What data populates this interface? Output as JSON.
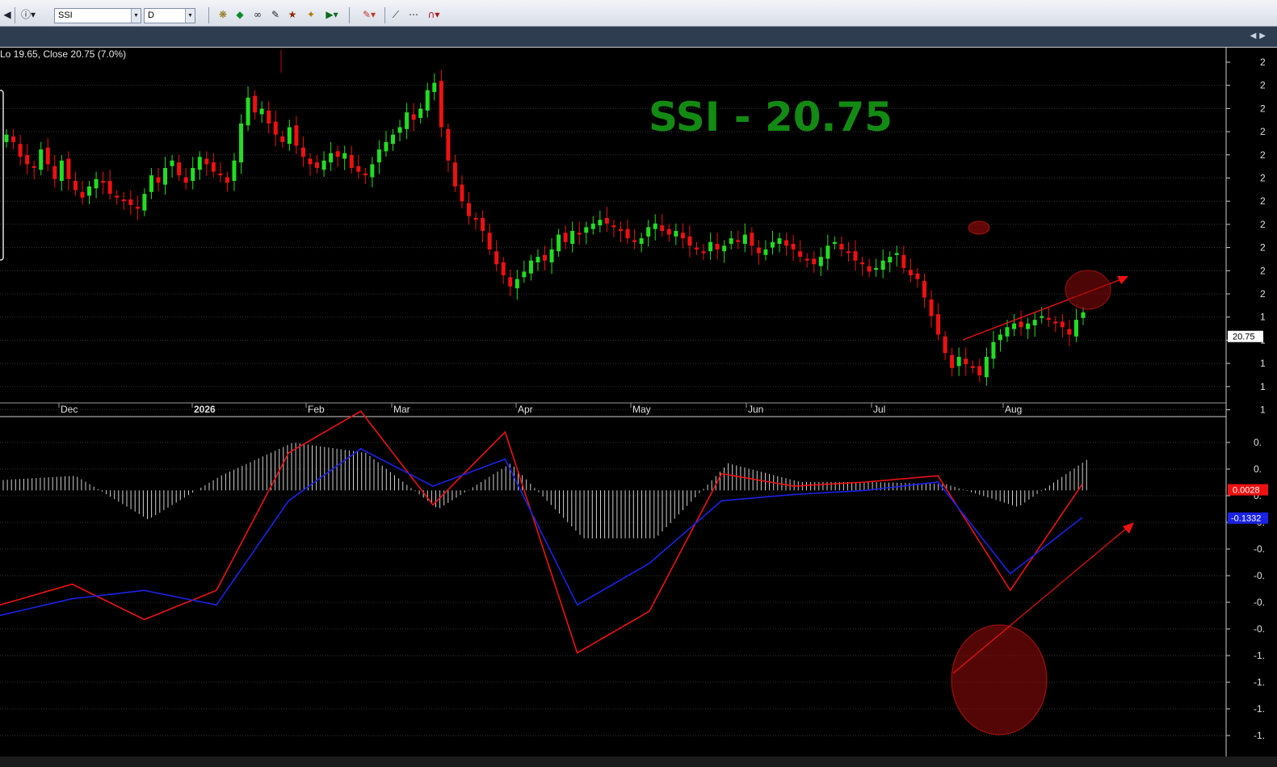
{
  "toolbar": {
    "symbol_value": "SSI",
    "interval_value": "D",
    "icons": [
      "back-icon",
      "info-icon",
      "symbol-dropdown",
      "interval-dropdown",
      "indicator-icon",
      "buy-icon",
      "glasses-icon",
      "pencil-icon",
      "wizard-icon",
      "magic-icon",
      "play-icon",
      "color-icon",
      "line-draw-icon",
      "dotted-line-icon",
      "magnet-icon"
    ]
  },
  "header": {
    "status_text": "Lo 19.65, Close 20.75 (7.0%)"
  },
  "annotation": {
    "title": "SSI - 20.75",
    "color": "#138a13"
  },
  "colors": {
    "background": "#000000",
    "up_candle": "#22dd22",
    "down_candle": "#ee1111",
    "macd_line": "#ee1111",
    "signal_line": "#1a22e6",
    "histogram": "#cfcfcf",
    "grid": "#333333",
    "price_badge": "#ffffff"
  },
  "chart_data": [
    {
      "type": "candlestick",
      "title": "",
      "last_close": 20.75,
      "price_badge": "20.75",
      "x_tick_labels": [
        "Dec",
        "2026",
        "Feb",
        "Mar",
        "Apr",
        "May",
        "Jun",
        "Jul",
        "Aug"
      ],
      "y_axis_labels": [
        "2",
        "2",
        "2",
        "2",
        "2",
        "2",
        "2",
        "2",
        "2",
        "2",
        "2",
        "1",
        "1",
        "1",
        "1",
        "1"
      ],
      "closes": [
        26.2,
        26.0,
        25.6,
        25.4,
        25.3,
        25.8,
        25.4,
        25.0,
        25.5,
        25.0,
        24.7,
        24.5,
        24.8,
        25.0,
        24.9,
        24.6,
        24.5,
        24.4,
        24.3,
        24.2,
        24.6,
        25.1,
        24.9,
        25.3,
        25.5,
        25.1,
        24.9,
        25.3,
        25.6,
        25.4,
        25.2,
        25.1,
        24.9,
        25.5,
        26.5,
        27.2,
        26.8,
        26.9,
        26.5,
        26.2,
        26.0,
        26.4,
        25.9,
        25.6,
        25.4,
        25.3,
        25.5,
        25.7,
        25.6,
        25.7,
        25.3,
        25.2,
        25.1,
        25.4,
        25.8,
        26.0,
        26.2,
        26.4,
        26.8,
        26.6,
        26.9,
        27.4,
        27.6,
        26.4,
        25.5,
        24.8,
        24.4,
        24.0,
        23.9,
        23.6,
        23.1,
        22.7,
        22.4,
        22.1,
        22.3,
        22.5,
        22.8,
        22.9,
        22.8,
        23.1,
        23.5,
        23.3,
        23.6,
        23.5,
        23.7,
        23.8,
        23.9,
        23.8,
        23.7,
        23.6,
        23.4,
        23.3,
        23.4,
        23.7,
        23.8,
        23.6,
        23.5,
        23.6,
        23.4,
        23.2,
        23.1,
        23.0,
        23.3,
        23.1,
        23.2,
        23.4,
        23.3,
        23.5,
        23.2,
        23.0,
        23.1,
        23.3,
        23.4,
        23.2,
        23.1,
        22.9,
        22.8,
        22.7,
        22.9,
        23.2,
        23.3,
        23.1,
        23.0,
        22.8,
        22.7,
        22.5,
        22.6,
        22.8,
        22.9,
        23.0,
        22.6,
        22.4,
        22.3,
        21.8,
        21.3,
        20.8,
        20.3,
        19.9,
        20.2,
        20.0,
        19.9,
        19.7,
        20.2,
        20.6,
        20.8,
        21.0,
        21.1,
        21.0,
        21.1,
        21.2,
        21.3,
        21.2,
        21.1,
        21.0,
        20.8,
        21.2,
        21.4
      ]
    },
    {
      "type": "line",
      "title": "",
      "badges": {
        "macd": "0.0028",
        "signal": "-0.1332"
      },
      "y_axis_labels": [
        "0.",
        "0.",
        "0.",
        "-0.",
        "-0.",
        "-0.",
        "-0.",
        "-0.",
        "-1.",
        "-1.",
        "-1.",
        "-1."
      ],
      "x": [
        0,
        10,
        20,
        30,
        40,
        50,
        60,
        70,
        80,
        90,
        100,
        110,
        120,
        130,
        140,
        150
      ],
      "series": [
        {
          "values": [
            -0.55,
            -0.45,
            -0.62,
            -0.48,
            0.18,
            0.38,
            -0.07,
            0.28,
            -0.78,
            -0.58,
            0.08,
            0.02,
            0.04,
            0.07,
            -0.48,
            0.03
          ]
        },
        {
          "values": [
            -0.6,
            -0.52,
            -0.48,
            -0.55,
            -0.05,
            0.2,
            0.02,
            0.15,
            -0.55,
            -0.35,
            -0.05,
            -0.02,
            0.0,
            0.04,
            -0.4,
            -0.13
          ]
        }
      ],
      "histogram": [
        0.05,
        0.07,
        -0.14,
        0.07,
        0.23,
        0.18,
        -0.09,
        0.13,
        -0.23,
        -0.23,
        0.13,
        0.04,
        0.04,
        0.03,
        -0.08,
        0.16
      ]
    }
  ]
}
